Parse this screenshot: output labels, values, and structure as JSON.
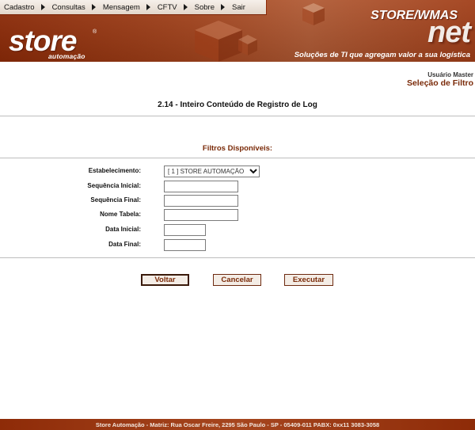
{
  "menu": [
    {
      "label": "Cadastro"
    },
    {
      "label": "Consultas"
    },
    {
      "label": "Mensagem"
    },
    {
      "label": "CFTV"
    },
    {
      "label": "Sobre"
    },
    {
      "label": "Sair"
    }
  ],
  "banner": {
    "logo": "store",
    "logo_registered": "®",
    "logo_sub": "automação",
    "product_top": "STORE/WMAS",
    "product_main": "net",
    "slogan": "Soluções de TI que agregam valor a sua logística"
  },
  "user": {
    "name": "Usuário Master",
    "section": "Seleção de Filtro"
  },
  "page_title": "2.14 - Inteiro Conteúdo de Registro de Log",
  "filters_title": "Filtros Disponíveis:",
  "form": {
    "estabelecimento": {
      "label": "Estabelecimento:",
      "value": "[ 1 ] STORE AUTOMAÇÃO"
    },
    "sequencia_inicial": {
      "label": "Sequência Inicial:",
      "value": ""
    },
    "sequencia_final": {
      "label": "Sequência Final:",
      "value": ""
    },
    "nome_tabela": {
      "label": "Nome Tabela:",
      "value": ""
    },
    "data_inicial": {
      "label": "Data Inicial:",
      "value": ""
    },
    "data_final": {
      "label": "Data Final:",
      "value": ""
    }
  },
  "buttons": {
    "voltar": "Voltar",
    "cancelar": "Cancelar",
    "executar": "Executar"
  },
  "footer": "Store Automação - Matriz: Rua Oscar Freire, 2295 São Paulo - SP - 05409-011 PABX: 0xx11 3083-3058"
}
